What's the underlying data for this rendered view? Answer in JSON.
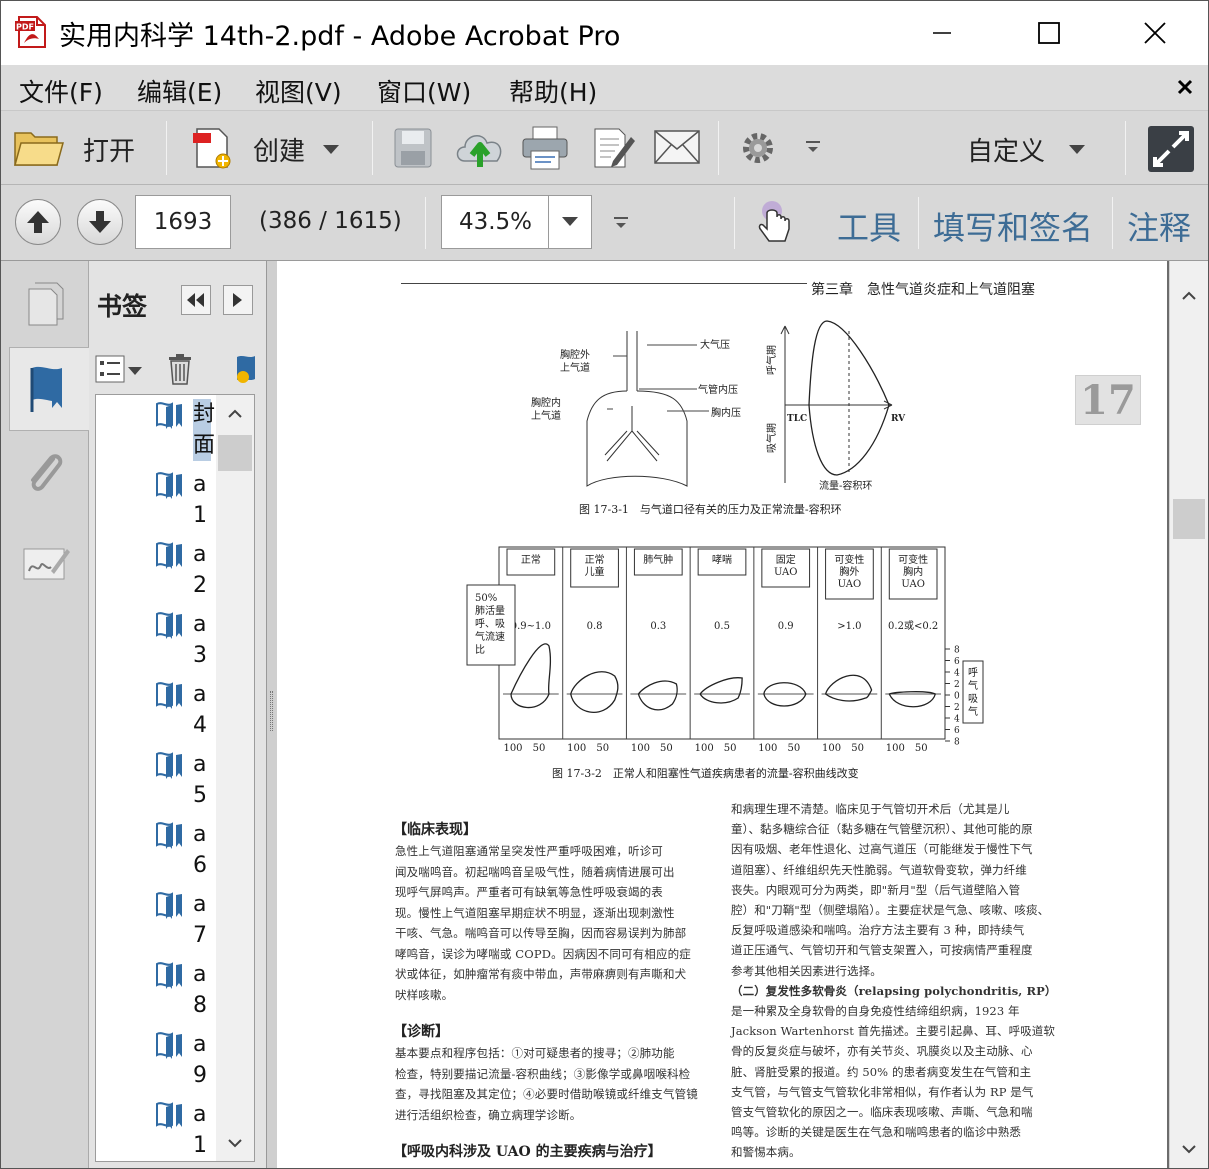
{
  "window": {
    "title": "实用内科学 14th-2.pdf - Adobe Acrobat Pro",
    "pdf_icon_label": "PDF"
  },
  "menu": [
    "文件(F)",
    "编辑(E)",
    "视图(V)",
    "窗口(W)",
    "帮助(H)"
  ],
  "toolbar": {
    "open_label": "打开",
    "create_label": "创建",
    "customize_label": "自定义"
  },
  "nav": {
    "page_number": "1693",
    "page_info": "(386 / 1615)",
    "zoom": "43.5%",
    "tabs": [
      "工具",
      "填写和签名",
      "注释"
    ]
  },
  "bookmarks": {
    "title": "书签",
    "items": [
      {
        "label": "封面",
        "selected": true
      },
      {
        "label": "a1"
      },
      {
        "label": "a2"
      },
      {
        "label": "a3"
      },
      {
        "label": "a4"
      },
      {
        "label": "a5"
      },
      {
        "label": "a6"
      },
      {
        "label": "a7"
      },
      {
        "label": "a8"
      },
      {
        "label": "a9"
      },
      {
        "label": "a1"
      }
    ]
  },
  "document": {
    "header": "第三章　急性气道炎症和上气道阻塞",
    "chapter_tab": "17",
    "fig1": {
      "labels": [
        "胸腔外",
        "上气道",
        "胸腔内",
        "上气道",
        "大气压",
        "气管内压",
        "胸内压"
      ],
      "loop_labels": {
        "ylabel_top": "呼气期",
        "ylabel_bottom": "吸气期",
        "tlc": "TLC",
        "rv": "RV",
        "xlabel": "流量-容积环"
      },
      "caption": "图 17-3-1　与气道口径有关的压力及正常流量-容积环"
    },
    "fig2": {
      "row_label": [
        "50%",
        "肺活量",
        "呼、吸",
        "气流速",
        "比"
      ],
      "columns": [
        {
          "name": [
            "正常"
          ],
          "ratio": "0.9~1.0"
        },
        {
          "name": [
            "正常",
            "儿童"
          ],
          "ratio": "0.8"
        },
        {
          "name": [
            "肺气肿"
          ],
          "ratio": "0.3"
        },
        {
          "name": [
            "哮喘"
          ],
          "ratio": "0.5"
        },
        {
          "name": [
            "固定",
            "UAO"
          ],
          "ratio": "0.9"
        },
        {
          "name": [
            "可变性",
            "胸外",
            "UAO"
          ],
          "ratio": ">1.0"
        },
        {
          "name": [
            "可变性",
            "胸内",
            "UAO"
          ],
          "ratio": "0.2或<0.2"
        }
      ],
      "x_ticks": [
        "100",
        "50"
      ],
      "y_ticks": [
        "8",
        "6",
        "4",
        "2",
        "0",
        "2",
        "4",
        "6",
        "8"
      ],
      "side_label": [
        "呼",
        "气",
        "吸",
        "气"
      ],
      "caption": "图 17-3-2　正常人和阻塞性气道疾病患者的流量-容积曲线改变"
    },
    "left_col": [
      {
        "type": "h",
        "text": "【临床表现】"
      },
      {
        "type": "p",
        "text": "急性上气道阻塞通常呈突发性严重呼吸困难，听诊可"
      },
      {
        "type": "p",
        "text": "闻及喘鸣音。初起喘鸣音呈吸气性，随着病情进展可出"
      },
      {
        "type": "p",
        "text": "现呼气屏鸣声。严重者可有缺氧等急性呼吸衰竭的表"
      },
      {
        "type": "p",
        "text": "现。慢性上气道阻塞早期症状不明显，逐渐出现刺激性"
      },
      {
        "type": "p",
        "text": "干咳、气急。喘鸣音可以传导至胸，因而容易误判为肺部"
      },
      {
        "type": "p",
        "text": "哮鸣音，误诊为哮喘或 COPD。因病因不同可有相应的症"
      },
      {
        "type": "p",
        "text": "状或体征，如肿瘤常有痰中带血，声带麻痹则有声嘶和犬"
      },
      {
        "type": "p",
        "text": "吠样咳嗽。"
      },
      {
        "type": "h",
        "text": "【诊断】"
      },
      {
        "type": "p",
        "text": "基本要点和程序包括：①对可疑患者的搜寻；②肺功能"
      },
      {
        "type": "p",
        "text": "检查，特别要描记流量-容积曲线；③影像学或鼻咽喉科检"
      },
      {
        "type": "p",
        "text": "查，寻找阻塞及其定位；④必要时借助喉镜或纤维支气管镜"
      },
      {
        "type": "p",
        "text": "进行活组织检查，确立病理学诊断。"
      },
      {
        "type": "h",
        "text": "【呼吸内科涉及 UAO 的主要疾病与治疗】"
      }
    ],
    "right_col": [
      "和病理生理不清楚。临床见于气管切开术后（尤其是儿",
      "童）、黏多糖综合征（黏多糖在气管壁沉积）、其他可能的原",
      "因有吸烟、老年性退化、过高气道压（可能继发于慢性下气",
      "道阻塞）、纤维组织先天性脆弱。气道软骨变软，弹力纤维",
      "丧失。内眼观可分为两类，即\"新月\"型（后气道壁陷入管",
      "腔）和\"刀鞘\"型（侧壁塌陷）。主要症状是气急、咳嗽、咳痰、",
      "反复呼吸道感染和喘鸣。治疗方法主要有 3 种，即持续气",
      "道正压通气、气管切开和气管支架置入，可按病情严重程度",
      "参考其他相关因素进行选择。",
      "（二）复发性多软骨炎（relapsing polychondritis, RP）",
      "是一种累及全身软骨的自身免疫性结缔组织病，1923 年",
      "Jackson Wartenhorst 首先描述。主要引起鼻、耳、呼吸道软",
      "骨的反复炎症与破坏，亦有关节炎、巩膜炎以及主动脉、心",
      "脏、肾脏受累的报道。约 50% 的患者病变发生在气管和主",
      "支气管，与气管支气管软化非常相似，有作者认为 RP 是气",
      "管支气管软化的原因之一。临床表现咳嗽、声嘶、气急和喘",
      "鸣等。诊断的关键是医生在气急和喘鸣患者的临诊中熟悉",
      "和警惕本病。"
    ]
  },
  "colors": {
    "menu_bg": "#dcdcdc",
    "toolbar_bg": "#d8d8d8",
    "tab_blue": "#3d6c95",
    "doc_bg": "#6c6c6c"
  }
}
